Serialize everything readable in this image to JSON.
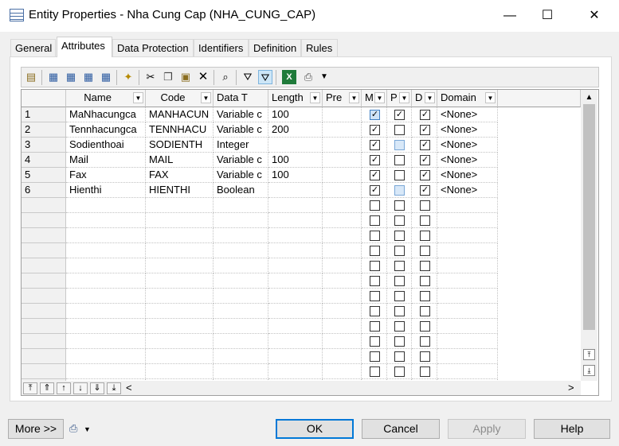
{
  "window": {
    "title": "Entity Properties - Nha Cung Cap (NHA_CUNG_CAP)",
    "minimize_glyph": "—",
    "maximize_glyph": "☐",
    "close_glyph": "✕"
  },
  "tabs": [
    "General",
    "Attributes",
    "Data Protection",
    "Identifiers",
    "Definition",
    "Rules"
  ],
  "active_tab": "Attributes",
  "grid": {
    "columns": [
      "Name",
      "Code",
      "Data T",
      "Length",
      "Pre",
      "M",
      "P",
      "D",
      "Domain"
    ],
    "rows": [
      {
        "num": "1",
        "name": "MaNhacungca",
        "code": "MANHACUN",
        "type": "Variable c",
        "length": "100",
        "m": "checked",
        "p": "checked",
        "d": "checked",
        "domain": "<None>"
      },
      {
        "num": "2",
        "name": "Tennhacungca",
        "code": "TENNHACU",
        "type": "Variable c",
        "length": "200",
        "m": "checked",
        "p": "unchecked",
        "d": "checked",
        "domain": "<None>"
      },
      {
        "num": "3",
        "name": "Sodienthoai",
        "code": "SODIENTH",
        "type": "Integer",
        "length": "",
        "m": "checked",
        "p": "disabled",
        "d": "checked",
        "domain": "<None>"
      },
      {
        "num": "4",
        "name": "Mail",
        "code": "MAIL",
        "type": "Variable c",
        "length": "100",
        "m": "checked",
        "p": "unchecked",
        "d": "checked",
        "domain": "<None>"
      },
      {
        "num": "5",
        "name": "Fax",
        "code": "FAX",
        "type": "Variable c",
        "length": "100",
        "m": "checked",
        "p": "unchecked",
        "d": "checked",
        "domain": "<None>"
      },
      {
        "num": "6",
        "name": "Hienthi",
        "code": "HIENTHI",
        "type": "Boolean",
        "length": "",
        "m": "checked",
        "p": "disabled",
        "d": "checked",
        "domain": "<None>"
      }
    ]
  },
  "buttons": {
    "more": "More >>",
    "ok": "OK",
    "cancel": "Cancel",
    "apply": "Apply",
    "help": "Help"
  },
  "colors": {
    "default_button_border": "#0078d7",
    "disabled_checkbox_fill": "#d8e8f8"
  }
}
